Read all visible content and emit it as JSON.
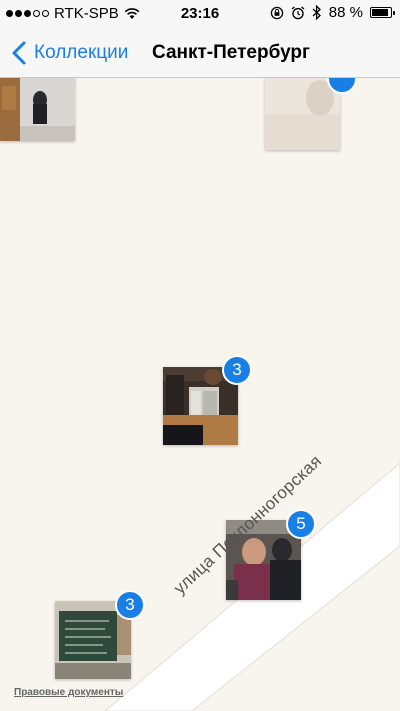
{
  "status_bar": {
    "carrier": "RTK-SPB",
    "time": "23:16",
    "battery_percent": "88 %",
    "battery_level": 0.88,
    "signal_bars_filled": 3,
    "signal_bars_total": 5,
    "icons": [
      "wifi-icon",
      "rotation-lock-icon",
      "alarm-icon",
      "bluetooth-icon",
      "battery-icon"
    ]
  },
  "nav_bar": {
    "back_label": "Коллекции",
    "title": "Санкт-Петербург",
    "accent_color": "#1a7fe5"
  },
  "map": {
    "street_name": "улица Поклонногорская",
    "legal_link": "Правовые документы",
    "clusters": [
      {
        "count": "3"
      },
      {
        "count": "5"
      },
      {
        "count": "3"
      }
    ]
  }
}
